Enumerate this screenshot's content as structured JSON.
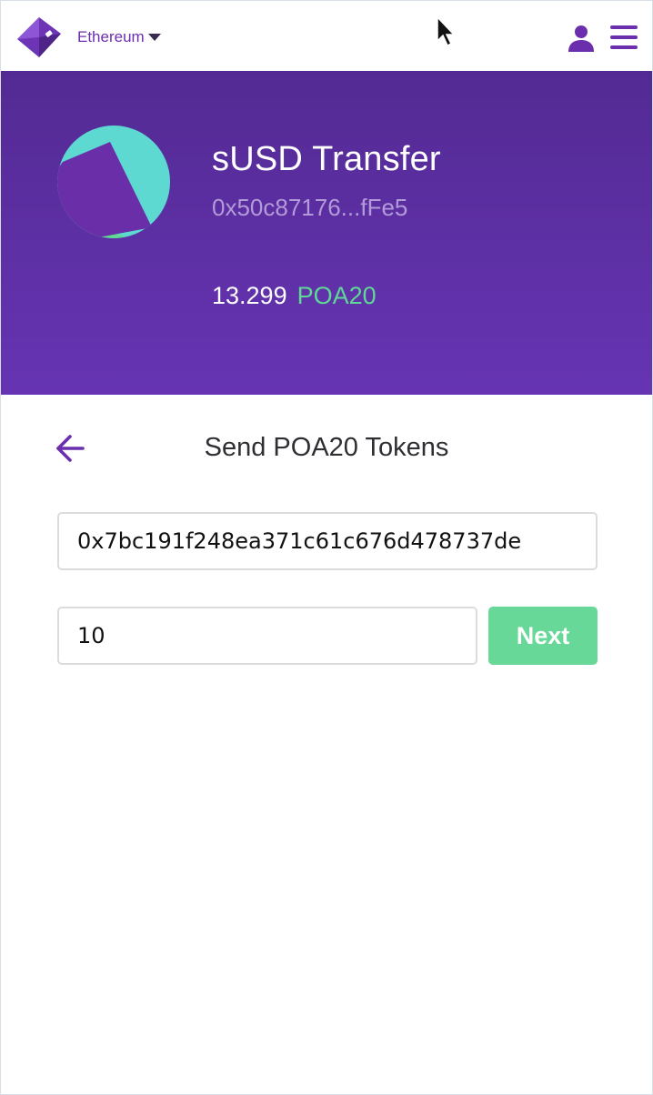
{
  "header": {
    "network": "Ethereum"
  },
  "token": {
    "name": "sUSD Transfer",
    "address": "0x50c87176...fFe5",
    "balance": "13.299",
    "symbol": "POA20"
  },
  "send": {
    "title": "Send POA20 Tokens",
    "recipient_value": "0x7bc191f248ea371c61c676d478737de",
    "amount_value": "10",
    "next_label": "Next"
  },
  "icons": {
    "logo": "wallet-logo-icon",
    "network_dropdown": "caret-down-icon",
    "user": "user-icon",
    "menu": "hamburger-menu-icon",
    "back": "arrow-left-icon",
    "avatar": "token-identicon"
  },
  "colors": {
    "brand_purple": "#6b2fae",
    "hero_top": "#532a93",
    "hero_bottom": "#6634b3",
    "accent_green": "#5fd896",
    "button_green": "#67d897",
    "address_muted": "#b39ad9"
  }
}
